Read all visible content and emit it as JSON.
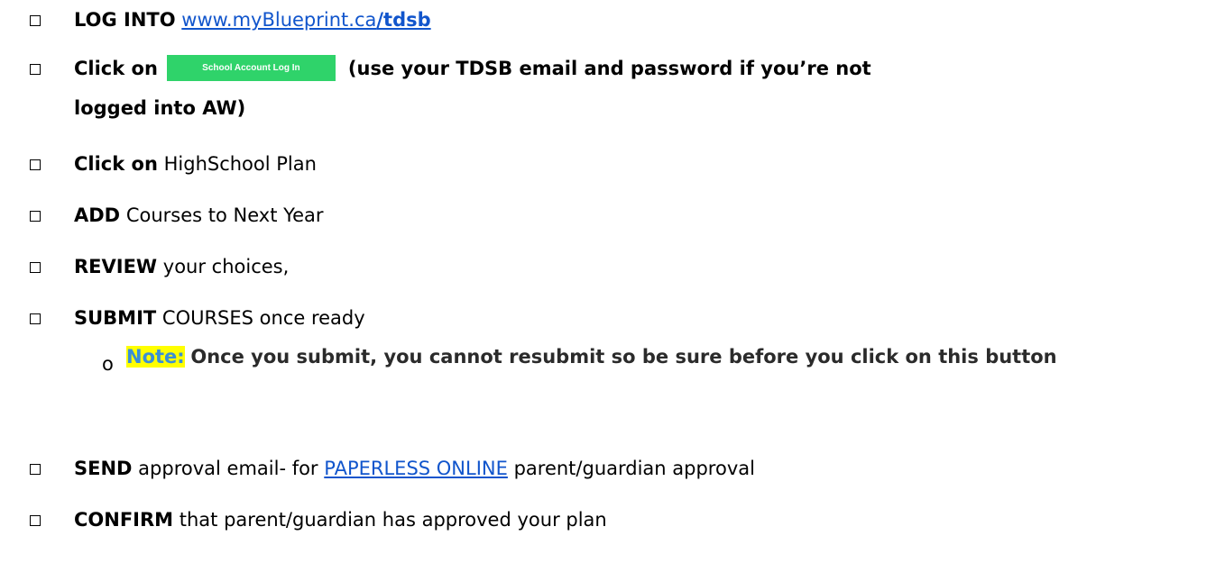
{
  "checklist": [
    {
      "bold": "LOG INTO",
      "link_plain": "www.myBlueprint.ca",
      "link_bold": "/tdsb"
    },
    {
      "bold": "Click on",
      "button_label": "School Account Log In",
      "after": "(use your TDSB email and password if you’re not",
      "line2": "logged into AW)"
    },
    {
      "bold": "Click on",
      "rest": "HighSchool Plan"
    },
    {
      "bold": "ADD",
      "rest": "Courses to Next Year"
    },
    {
      "bold": "REVIEW",
      "rest": "your choices,"
    },
    {
      "bold": "SUBMIT",
      "rest": "COURSES once ready"
    },
    {
      "bullet": "o",
      "note_label": "Note:",
      "note_text": "Once you submit, you cannot resubmit so be sure before you click on this button"
    },
    {
      "bold": "SEND",
      "rest_before": "approval email- for",
      "link": "PAPERLESS ONLINE",
      "rest_after": "parent/guardian approval"
    },
    {
      "bold": "CONFIRM",
      "rest": "that parent/guardian has approved your plan"
    }
  ]
}
